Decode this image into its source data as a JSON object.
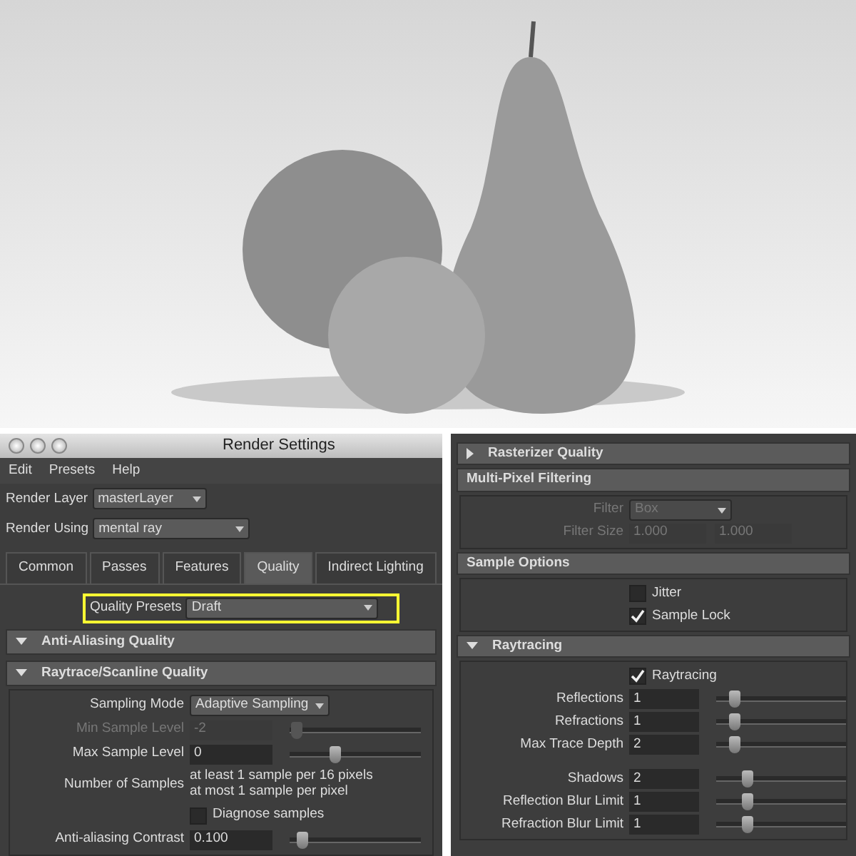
{
  "window": {
    "title": "Render Settings"
  },
  "menu": [
    "Edit",
    "Presets",
    "Help"
  ],
  "render_layer": {
    "label": "Render Layer",
    "value": "masterLayer"
  },
  "render_using": {
    "label": "Render Using",
    "value": "mental ray"
  },
  "tabs": [
    {
      "label": "Common",
      "selected": false
    },
    {
      "label": "Passes",
      "selected": false
    },
    {
      "label": "Features",
      "selected": false
    },
    {
      "label": "Quality",
      "selected": true
    },
    {
      "label": "Indirect Lighting",
      "selected": false
    }
  ],
  "quality_presets": {
    "label": "Quality Presets",
    "value": "Draft",
    "highlighted": true
  },
  "left_sections": [
    {
      "title": "Anti-Aliasing Quality",
      "kind": "rollout",
      "expanded": true
    },
    {
      "title": "Raytrace/Scanline Quality",
      "kind": "rollout",
      "expanded": true,
      "rows": [
        {
          "kind": "dropdown",
          "label": "Sampling Mode",
          "value": "Adaptive Sampling",
          "disabled": false
        },
        {
          "kind": "slider",
          "label": "Min Sample Level",
          "value": "-2",
          "level": 0.05,
          "disabled": true
        },
        {
          "kind": "slider",
          "label": "Max Sample Level",
          "value": "0",
          "level": 0.35,
          "disabled": false
        },
        {
          "kind": "text",
          "label": "Number of Samples",
          "lines": [
            "at least 1 sample per 16 pixels",
            "at most 1 sample per pixel"
          ]
        },
        {
          "kind": "checkbox",
          "label": "Diagnose samples",
          "checked": false
        },
        {
          "kind": "slider",
          "label": "Anti-aliasing Contrast",
          "value": "0.100",
          "level": 0.1,
          "disabled": false
        }
      ]
    }
  ],
  "right_sections": [
    {
      "title": "Rasterizer Quality",
      "kind": "rollout",
      "expanded": false
    },
    {
      "title": "Multi-Pixel Filtering",
      "kind": "frame",
      "rows": [
        {
          "kind": "dropdown",
          "label": "Filter",
          "value": "Box",
          "disabled": true
        },
        {
          "kind": "pair",
          "label": "Filter Size",
          "values": [
            "1.000",
            "1.000"
          ],
          "disabled": true
        }
      ]
    },
    {
      "title": "Sample Options",
      "kind": "frame",
      "rows": [
        {
          "kind": "checkbox",
          "label": "Jitter",
          "checked": false
        },
        {
          "kind": "checkbox",
          "label": "Sample Lock",
          "checked": true
        }
      ]
    },
    {
      "title": "Raytracing",
      "kind": "rollout",
      "expanded": true,
      "rows": [
        {
          "kind": "checkbox",
          "label": "Raytracing",
          "checked": true
        },
        {
          "kind": "slider",
          "label": "Reflections",
          "value": "1",
          "level": 0.14,
          "disabled": false
        },
        {
          "kind": "slider",
          "label": "Refractions",
          "value": "1",
          "level": 0.14,
          "disabled": false
        },
        {
          "kind": "slider",
          "label": "Max Trace Depth",
          "value": "2",
          "level": 0.14,
          "disabled": false
        },
        {
          "kind": "spacer"
        },
        {
          "kind": "slider",
          "label": "Shadows",
          "value": "2",
          "level": 0.24,
          "disabled": false
        },
        {
          "kind": "slider",
          "label": "Reflection Blur Limit",
          "value": "1",
          "level": 0.24,
          "disabled": false
        },
        {
          "kind": "slider",
          "label": "Refraction Blur Limit",
          "value": "1",
          "level": 0.24,
          "disabled": false
        }
      ]
    }
  ]
}
